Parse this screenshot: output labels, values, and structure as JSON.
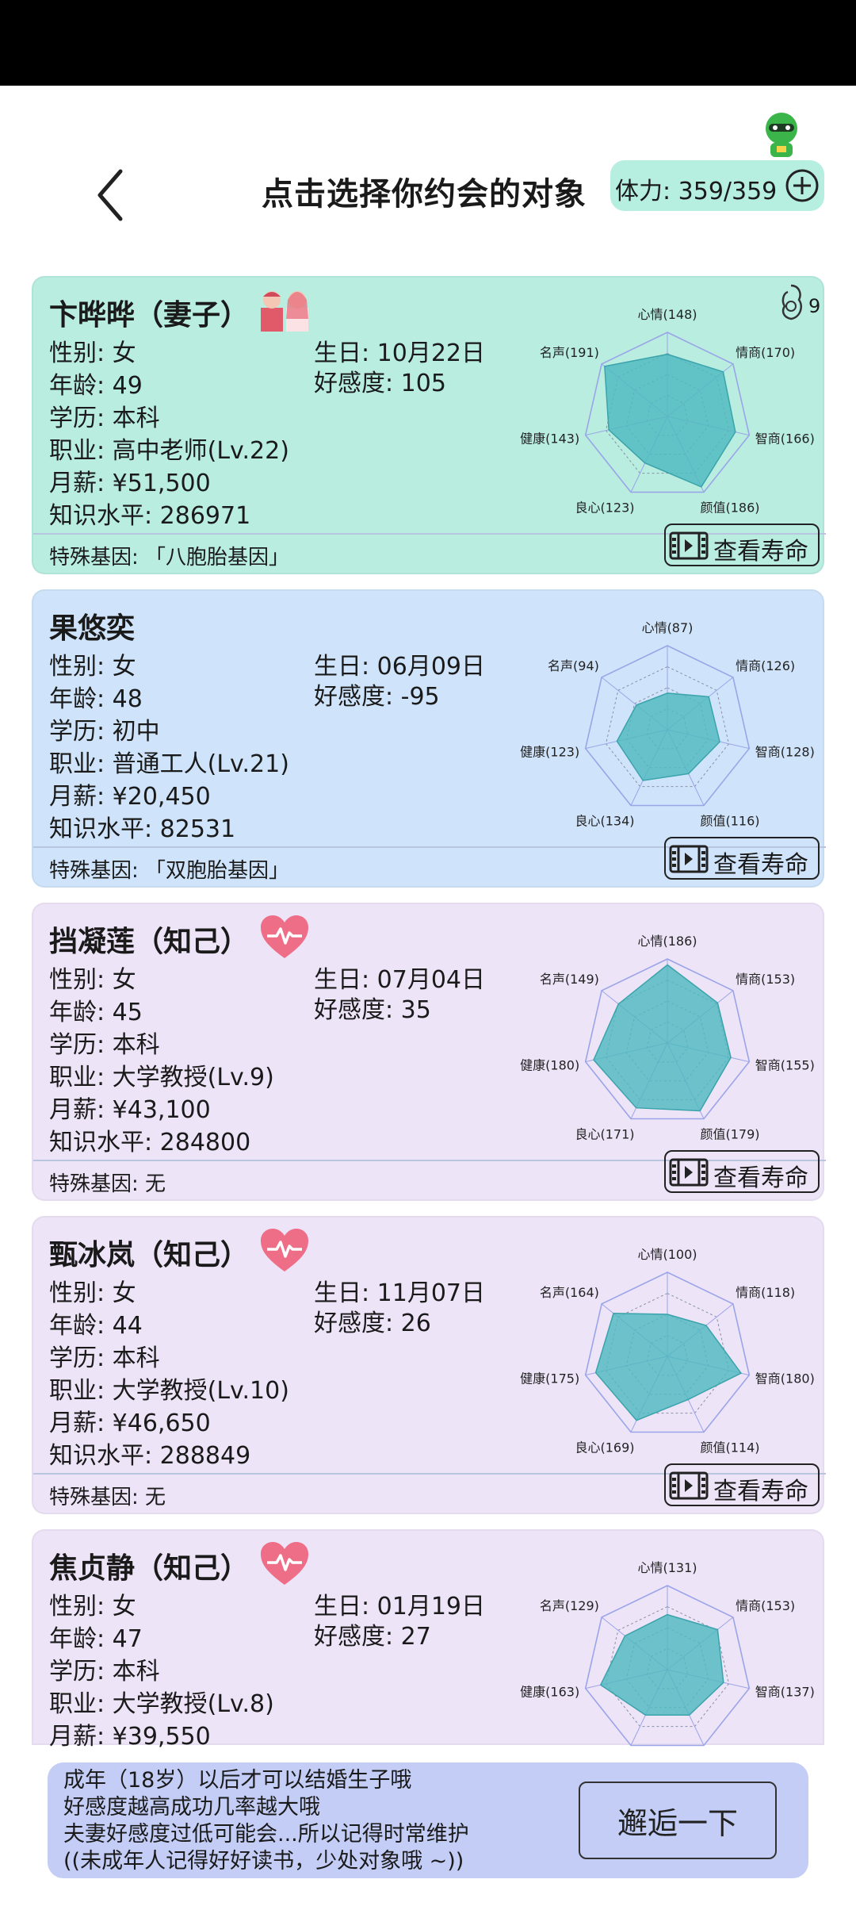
{
  "header": {
    "title": "点击选择你约会的对象",
    "stamina": "体力: 359/359"
  },
  "radar_axes_order": [
    "心情",
    "情商",
    "智商",
    "颜值",
    "良心",
    "健康",
    "名声"
  ],
  "partners": [
    {
      "name": "卞晔晔（妻子）",
      "relationship": "spouse",
      "relationship_icon": "wedding-couple-icon",
      "children": "9",
      "gender": "性别: 女",
      "age": "年龄: 49",
      "education": "学历: 本科",
      "job": "职业: 高中老师(Lv.22)",
      "salary": "月薪: ¥51,500",
      "knowledge": "知识水平: 286971",
      "birthday": "生日: 10月22日",
      "affection": "好感度: 105",
      "gene": "特殊基因: 「八胞胎基因」",
      "life_button": "查看寿命",
      "theme": "#b8ede0",
      "radar": {
        "心情": 148,
        "情商": 170,
        "智商": 166,
        "颜值": 186,
        "良心": 123,
        "健康": 143,
        "名声": 191
      },
      "radar_labels": [
        "心情(148)",
        "情商(170)",
        "智商(166)",
        "颜值(186)",
        "良心(123)",
        "健康(143)",
        "名声(191)"
      ]
    },
    {
      "name": "果悠奕",
      "relationship": "none",
      "relationship_icon": "",
      "children": "",
      "gender": "性别: 女",
      "age": "年龄: 48",
      "education": "学历: 初中",
      "job": "职业: 普通工人(Lv.21)",
      "salary": "月薪: ¥20,450",
      "knowledge": "知识水平: 82531",
      "birthday": "生日: 06月09日",
      "affection": "好感度: -95",
      "gene": "特殊基因: 「双胞胎基因」",
      "life_button": "查看寿命",
      "theme": "#cfe4fa",
      "radar": {
        "心情": 87,
        "情商": 126,
        "智商": 128,
        "颜值": 116,
        "良心": 134,
        "健康": 123,
        "名声": 94
      },
      "radar_labels": [
        "心情(87)",
        "情商(126)",
        "智商(128)",
        "颜值(116)",
        "良心(134)",
        "健康(123)",
        "名声(94)"
      ]
    },
    {
      "name": "挡凝莲（知己）",
      "relationship": "confidant",
      "relationship_icon": "heartbeat-icon",
      "children": "",
      "gender": "性别: 女",
      "age": "年龄: 45",
      "education": "学历: 本科",
      "job": "职业: 大学教授(Lv.9)",
      "salary": "月薪: ¥43,100",
      "knowledge": "知识水平: 284800",
      "birthday": "生日: 07月04日",
      "affection": "好感度: 35",
      "gene": "特殊基因: 无",
      "life_button": "查看寿命",
      "theme": "#eee4f8",
      "radar": {
        "心情": 186,
        "情商": 153,
        "智商": 155,
        "颜值": 179,
        "良心": 171,
        "健康": 180,
        "名声": 149
      },
      "radar_labels": [
        "心情(186)",
        "情商(153)",
        "智商(155)",
        "颜值(179)",
        "良心(171)",
        "健康(180)",
        "名声(149)"
      ]
    },
    {
      "name": "甄冰岚（知己）",
      "relationship": "confidant",
      "relationship_icon": "heartbeat-icon",
      "children": "",
      "gender": "性别: 女",
      "age": "年龄: 44",
      "education": "学历: 本科",
      "job": "职业: 大学教授(Lv.10)",
      "salary": "月薪: ¥46,650",
      "knowledge": "知识水平: 288849",
      "birthday": "生日: 11月07日",
      "affection": "好感度: 26",
      "gene": "特殊基因: 无",
      "life_button": "查看寿命",
      "theme": "#eee4f8",
      "radar": {
        "心情": 100,
        "情商": 118,
        "智商": 180,
        "颜值": 114,
        "良心": 169,
        "健康": 175,
        "名声": 164
      },
      "radar_labels": [
        "心情(100)",
        "情商(118)",
        "智商(180)",
        "颜值(114)",
        "良心(169)",
        "健康(175)",
        "名声(164)"
      ]
    },
    {
      "name": "焦贞静（知己）",
      "relationship": "confidant",
      "relationship_icon": "heartbeat-icon",
      "children": "",
      "gender": "性别: 女",
      "age": "年龄: 47",
      "education": "学历: 本科",
      "job": "职业: 大学教授(Lv.8)",
      "salary": "月薪: ¥39,550",
      "knowledge": "",
      "birthday": "生日: 01月19日",
      "affection": "好感度: 27",
      "gene": "",
      "life_button": "",
      "theme": "#eee4f8",
      "radar": {
        "心情": 131,
        "情商": 153,
        "智商": 137,
        "名声": 129,
        "健康": 163
      },
      "radar_labels": [
        "心情(131)",
        "情商(153)",
        "智商(137)",
        "",
        "",
        "健康(163)",
        "名声(129)"
      ]
    }
  ],
  "tips": {
    "line1": "成年（18岁）以后才可以结婚生子哦",
    "line2": "好感度越高成功几率越大哦",
    "line3": "夫妻好感度过低可能会...所以记得时常维护",
    "line4": "((未成年人记得好好读书，少处对象哦 ~))",
    "button": "邂逅一下"
  }
}
